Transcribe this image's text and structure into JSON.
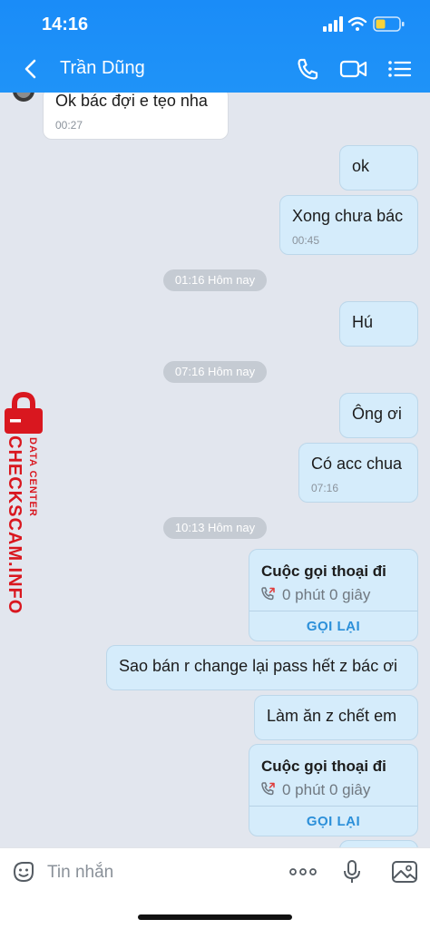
{
  "status_bar": {
    "time": "14:16"
  },
  "header": {
    "title": "Trần Dũng"
  },
  "chat": {
    "top_message": {
      "text": "Ok bác đợi e tẹo nha",
      "time": "00:27"
    },
    "messages": [
      {
        "text": "ok"
      },
      {
        "text": "Xong chưa bác",
        "time": "00:45"
      },
      {
        "text": "Hú"
      },
      {
        "text": "Ông ơi"
      },
      {
        "text": "Có acc chua",
        "time": "07:16"
      },
      {
        "text": "Sao bán r change lại pass hết z bác ơi"
      },
      {
        "text": "Làm ăn z chết em"
      }
    ],
    "separators": [
      "01:16 Hôm nay",
      "07:16 Hôm nay",
      "10:13 Hôm nay"
    ],
    "calls": [
      {
        "title": "Cuộc gọi thoại đi",
        "duration": "0 phút 0 giây",
        "action": "GỌI LẠI"
      },
      {
        "title": "Cuộc gọi thoại đi",
        "duration": "0 phút 0 giây",
        "action": "GỌI LẠI"
      }
    ]
  },
  "watermark": {
    "text": "CHECKSCAM.INFO",
    "sub": "DATA CENTER"
  },
  "composer": {
    "placeholder": "Tin nhắn"
  },
  "colors": {
    "header": "#1a8cf8",
    "outgoing_bubble": "#d5ecfb",
    "incoming_bubble": "#ffffff",
    "background": "#e2e6ee",
    "watermark": "#d9171f"
  }
}
